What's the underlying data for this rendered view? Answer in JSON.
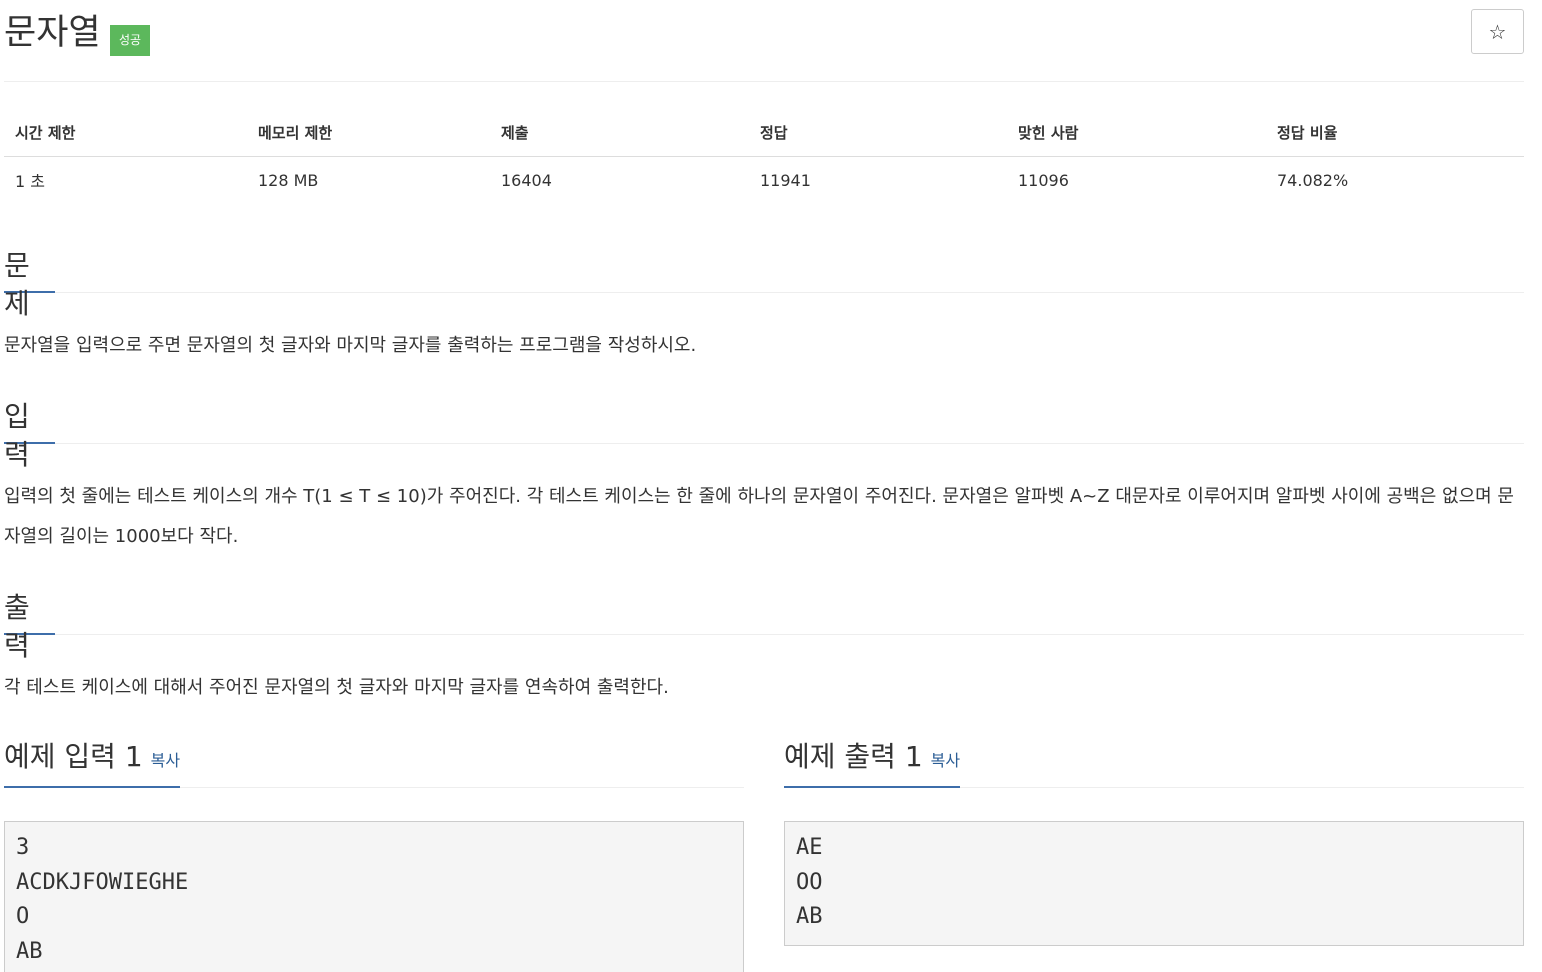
{
  "problem": {
    "title": "문자열",
    "status_badge": "성공",
    "star_icon": "star-outline-icon",
    "star_glyph": "☆"
  },
  "info_table": {
    "headers": [
      "시간 제한",
      "메모리 제한",
      "제출",
      "정답",
      "맞힌 사람",
      "정답 비율"
    ],
    "values": [
      "1 초",
      "128 MB",
      "16404",
      "11941",
      "11096",
      "74.082%"
    ]
  },
  "sections": {
    "problem": {
      "heading": "문제",
      "text": "문자열을 입력으로 주면 문자열의 첫 글자와 마지막 글자를 출력하는 프로그램을 작성하시오."
    },
    "input": {
      "heading": "입력",
      "text": "입력의 첫 줄에는 테스트 케이스의 개수 T(1 ≤ T ≤ 10)가 주어진다. 각 테스트 케이스는 한 줄에 하나의 문자열이 주어진다. 문자열은 알파벳 A~Z 대문자로 이루어지며 알파벳 사이에 공백은 없으며 문자열의 길이는 1000보다 작다."
    },
    "output": {
      "heading": "출력",
      "text": "각 테스트 케이스에 대해서 주어진 문자열의 첫 글자와 마지막 글자를 연속하여 출력한다."
    }
  },
  "samples": {
    "input": {
      "heading": "예제 입력 1",
      "copy_label": "복사",
      "content": "3\nACDKJFOWIEGHE\nO\nAB"
    },
    "output": {
      "heading": "예제 출력 1",
      "copy_label": "복사",
      "content": "AE\nOO\nAB"
    }
  },
  "colors": {
    "accent": "#3e6eaa",
    "success": "#5cb85c",
    "link": "#2b5d95"
  }
}
